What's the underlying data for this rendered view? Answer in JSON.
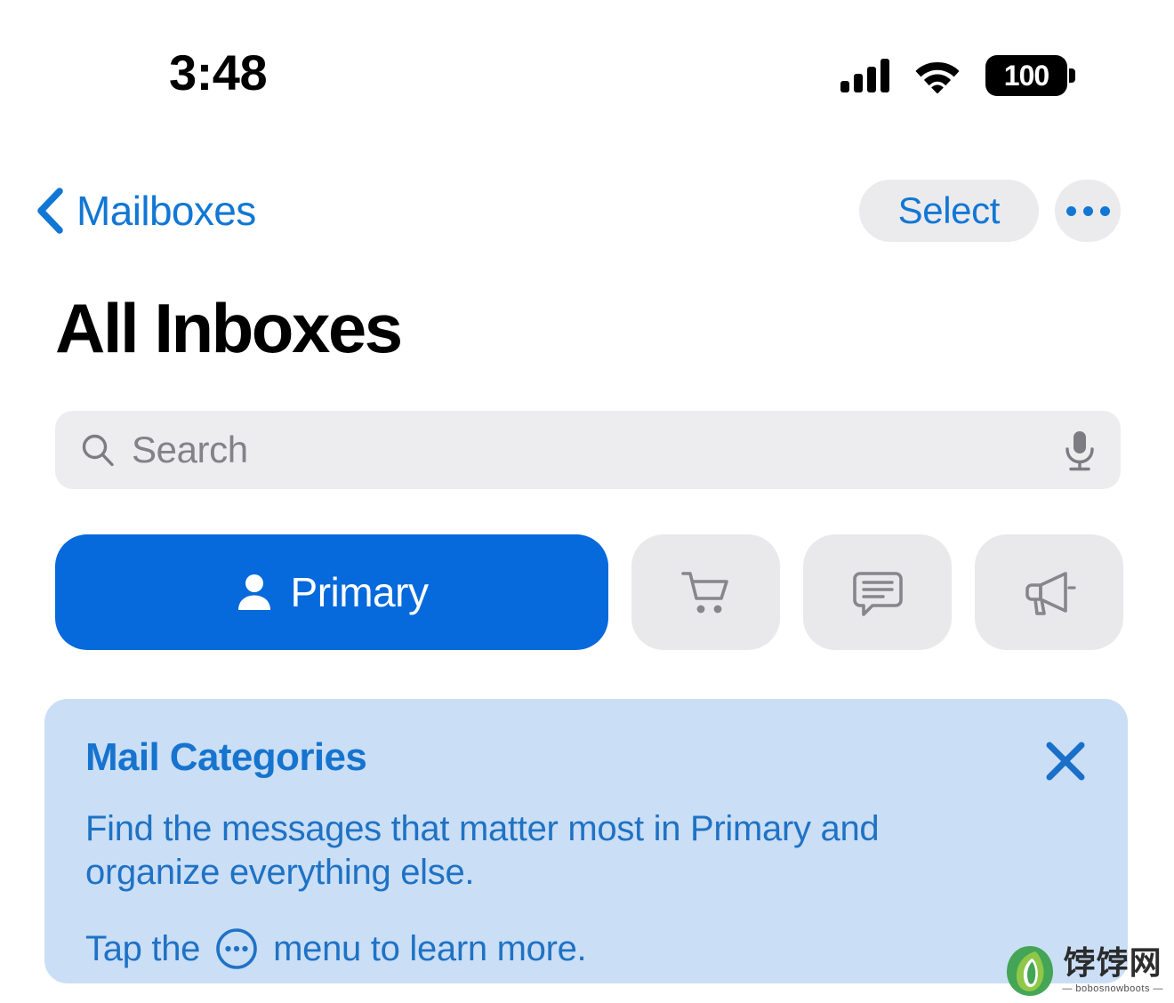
{
  "status_bar": {
    "time": "3:48",
    "signal_icon": "cellular-signal-icon",
    "signal_bars": 4,
    "wifi_icon": "wifi-icon",
    "battery_level": "100",
    "battery_icon": "battery-full-icon"
  },
  "nav": {
    "back_icon": "chevron-left-icon",
    "back_label": "Mailboxes",
    "select_label": "Select",
    "more_icon": "ellipsis-icon"
  },
  "page": {
    "title": "All Inboxes"
  },
  "search": {
    "icon": "search-icon",
    "placeholder": "Search",
    "value": "",
    "mic_icon": "microphone-icon"
  },
  "categories": [
    {
      "id": "primary",
      "label": "Primary",
      "icon": "person-icon",
      "selected": true
    },
    {
      "id": "transactions",
      "label": "",
      "icon": "shopping-cart-icon",
      "selected": false
    },
    {
      "id": "updates",
      "label": "",
      "icon": "chat-bubble-icon",
      "selected": false
    },
    {
      "id": "promotions",
      "label": "",
      "icon": "megaphone-icon",
      "selected": false
    }
  ],
  "info_card": {
    "title": "Mail Categories",
    "body": "Find the messages that matter most in Primary and organize everything else.",
    "tap_prefix": "Tap the",
    "tap_icon": "circle-ellipsis-icon",
    "tap_suffix": "menu to learn more.",
    "close_icon": "close-icon"
  },
  "watermark": {
    "logo_icon": "leaf-logo-icon",
    "cn_text": "饽饽网",
    "en_text": "— bobosnowboots —"
  },
  "colors": {
    "accent_blue": "#1277D4",
    "primary_button": "#0669DC",
    "pill_gray": "#E9E9EB",
    "search_gray": "#EDEDEF",
    "card_background": "#CADEF6",
    "card_text": "#1F72C4",
    "card_title": "#1674CE",
    "background": "#FFFFFF",
    "text_primary": "#000000"
  }
}
